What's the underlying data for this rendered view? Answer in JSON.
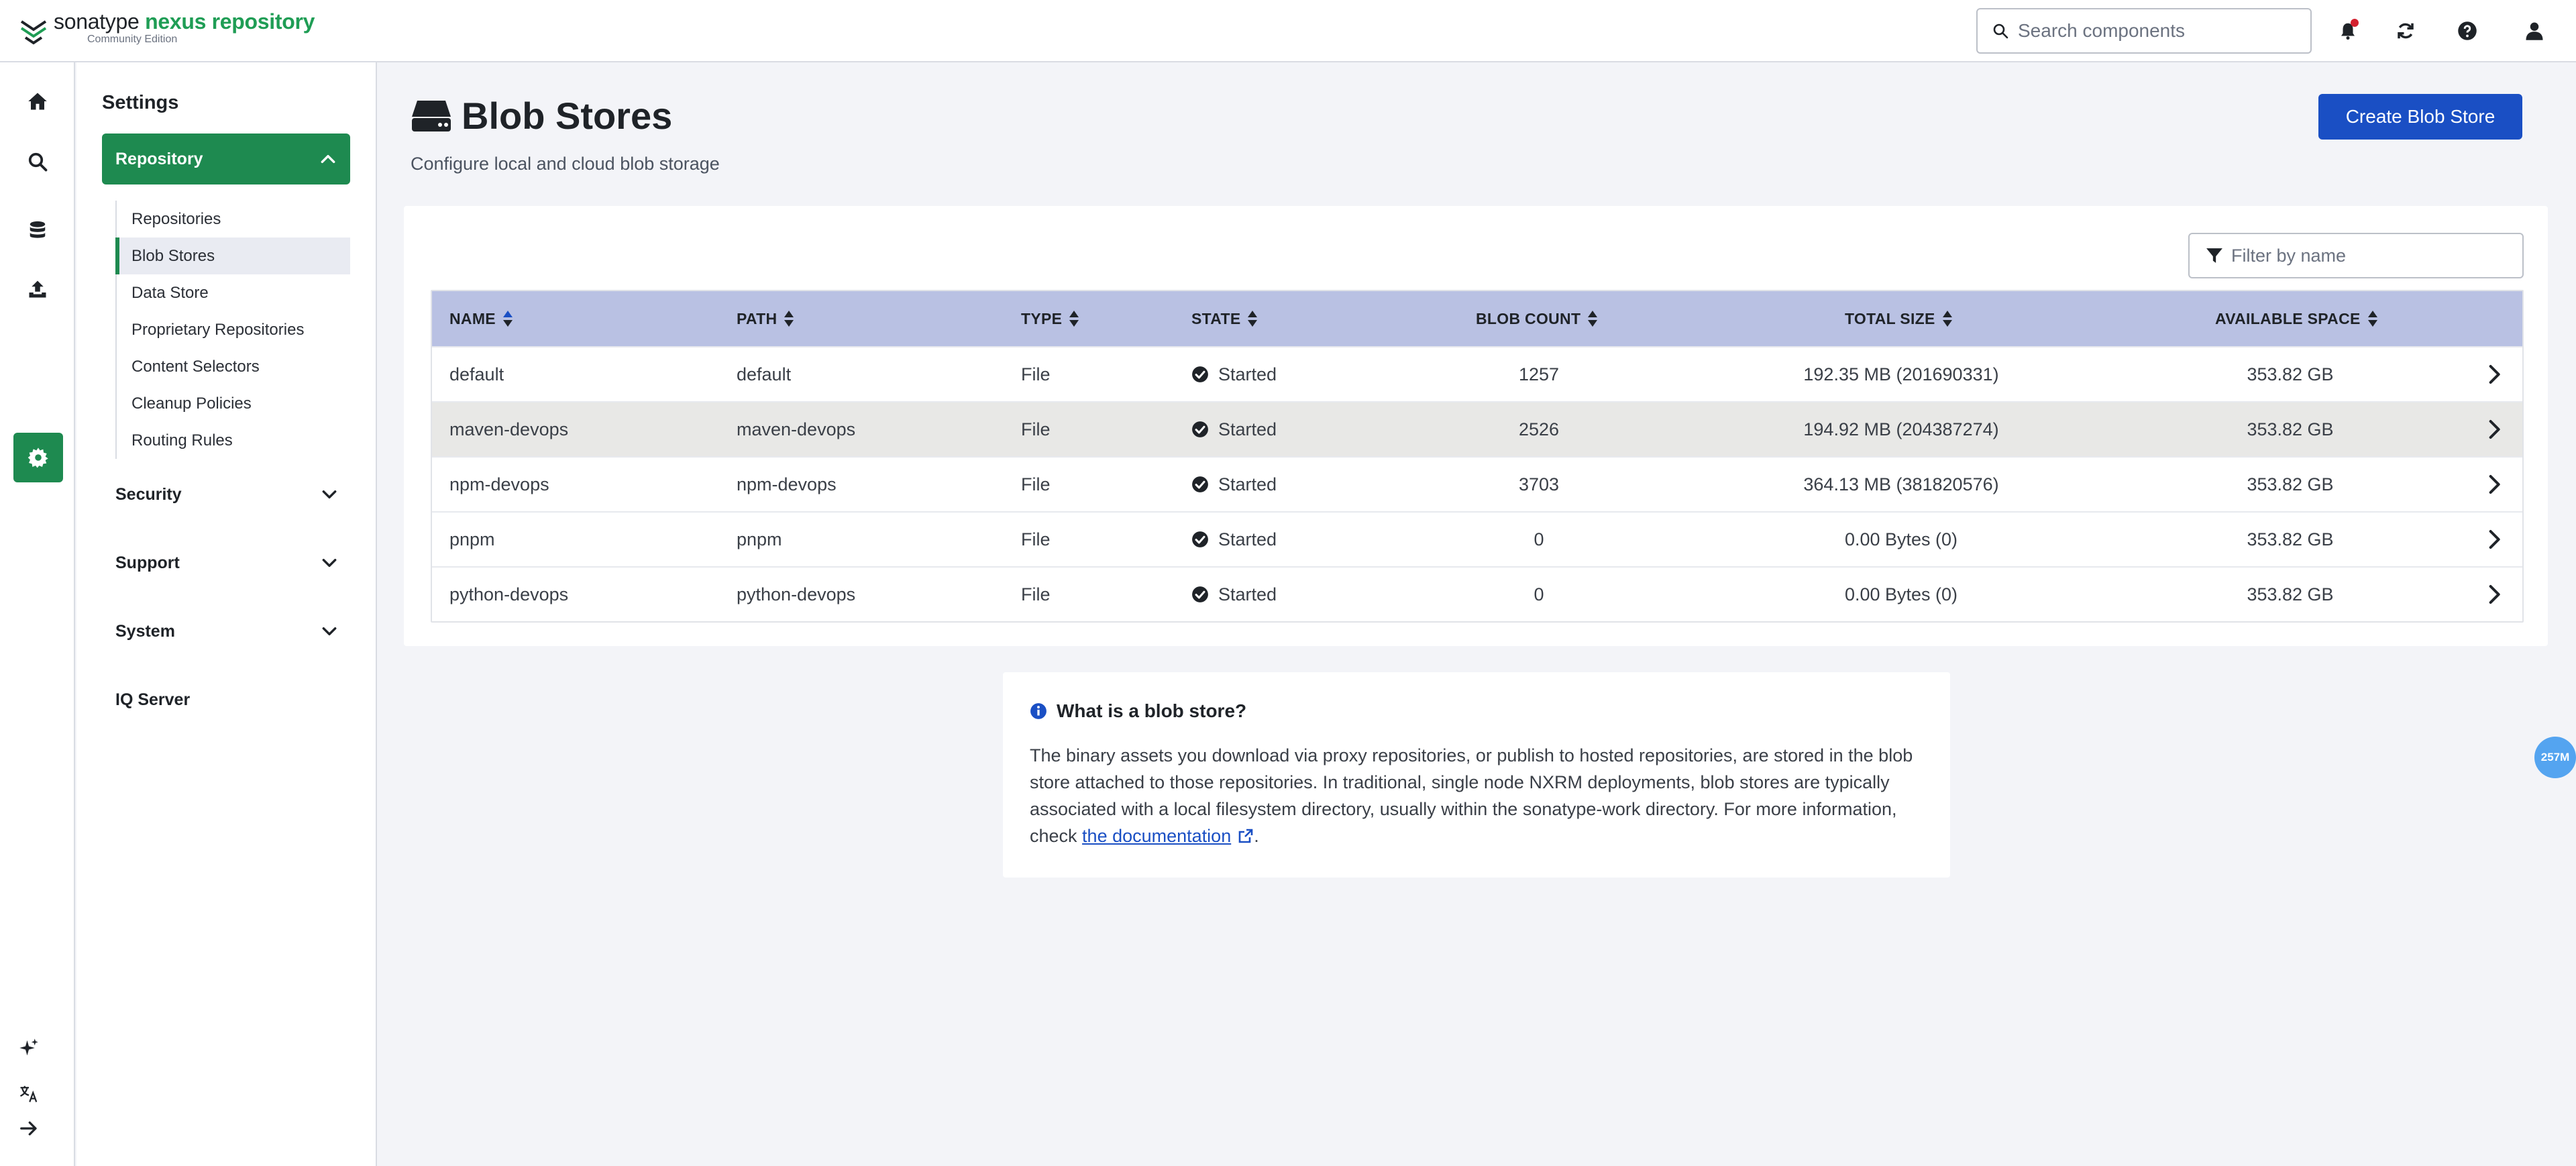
{
  "header": {
    "brand_a": "sonatype ",
    "brand_b": "nexus repository",
    "edition": "Community Edition",
    "search_placeholder": "Search components"
  },
  "sidebar": {
    "title": "Settings",
    "repository_label": "Repository",
    "repository_items": [
      {
        "label": "Repositories"
      },
      {
        "label": "Blob Stores"
      },
      {
        "label": "Data Store"
      },
      {
        "label": "Proprietary Repositories"
      },
      {
        "label": "Content Selectors"
      },
      {
        "label": "Cleanup Policies"
      },
      {
        "label": "Routing Rules"
      }
    ],
    "groups": {
      "security": "Security",
      "support": "Support",
      "system": "System",
      "iq_server": "IQ Server"
    }
  },
  "page": {
    "title": "Blob Stores",
    "description": "Configure local and cloud blob storage",
    "create_button": "Create Blob Store",
    "filter_placeholder": "Filter by name"
  },
  "table": {
    "columns": {
      "name": "NAME",
      "path": "PATH",
      "type": "TYPE",
      "state": "STATE",
      "blob_count": "BLOB COUNT",
      "total_size": "TOTAL SIZE",
      "available_space": "AVAILABLE SPACE"
    },
    "rows": [
      {
        "name": "default",
        "path": "default",
        "type": "File",
        "state": "Started",
        "blob_count": "1257",
        "total_size": "192.35 MB (201690331)",
        "available_space": "353.82 GB"
      },
      {
        "name": "maven-devops",
        "path": "maven-devops",
        "type": "File",
        "state": "Started",
        "blob_count": "2526",
        "total_size": "194.92 MB (204387274)",
        "available_space": "353.82 GB"
      },
      {
        "name": "npm-devops",
        "path": "npm-devops",
        "type": "File",
        "state": "Started",
        "blob_count": "3703",
        "total_size": "364.13 MB (381820576)",
        "available_space": "353.82 GB"
      },
      {
        "name": "pnpm",
        "path": "pnpm",
        "type": "File",
        "state": "Started",
        "blob_count": "0",
        "total_size": "0.00 Bytes (0)",
        "available_space": "353.82 GB"
      },
      {
        "name": "python-devops",
        "path": "python-devops",
        "type": "File",
        "state": "Started",
        "blob_count": "0",
        "total_size": "0.00 Bytes (0)",
        "available_space": "353.82 GB"
      }
    ]
  },
  "info": {
    "title": "What is a blob store?",
    "body": "The binary assets you download via proxy repositories, or publish to hosted repositories, are stored in the blob store attached to those repositories. In traditional, single node NXRM deployments, blob stores are typically associated with a local filesystem directory, usually within the sonatype-work directory. For more information, check ",
    "link": "the documentation",
    "end": "."
  },
  "memory_badge": "257M",
  "colors": {
    "brand_green": "#1e8a50",
    "primary_blue": "#1a4fc4",
    "table_header": "#b9c1e3"
  }
}
